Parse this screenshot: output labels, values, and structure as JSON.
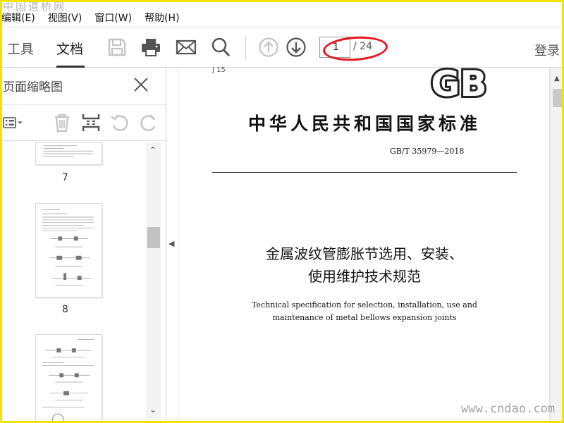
{
  "watermarks": {
    "top": "中国道桥网",
    "bottom": "www.cndao.com"
  },
  "menu": [
    "编辑(E)",
    "视图(V)",
    "窗口(W)",
    "帮助(H)"
  ],
  "tabs": [
    {
      "label": "工具",
      "active": false
    },
    {
      "label": "文档",
      "active": true
    }
  ],
  "toolbar": {
    "icons": [
      "save-icon",
      "print-icon",
      "mail-icon",
      "search-icon",
      "arrow-up-circle-icon",
      "arrow-down-circle-icon"
    ],
    "page_current": "1",
    "page_total": "/ 24",
    "login": "登录"
  },
  "sidebar": {
    "title": "页面缩略图",
    "thumbnails": [
      {
        "label": "7"
      },
      {
        "label": "8"
      }
    ]
  },
  "document": {
    "ics": "J 15",
    "logo": "GB",
    "standard_name": "中华人民共和国国家标准",
    "standard_number": "GB/T 35979—2018",
    "title_cn_line1": "金属波纹管膨胀节选用、安装、",
    "title_cn_line2": "使用维护技术规范",
    "title_en_line1": "Technical specification for selection, installation, use and",
    "title_en_line2": "maintenance of metal bellows expansion joints"
  },
  "colors": {
    "annotation": "#e8141b",
    "frame": "#f2e400"
  }
}
